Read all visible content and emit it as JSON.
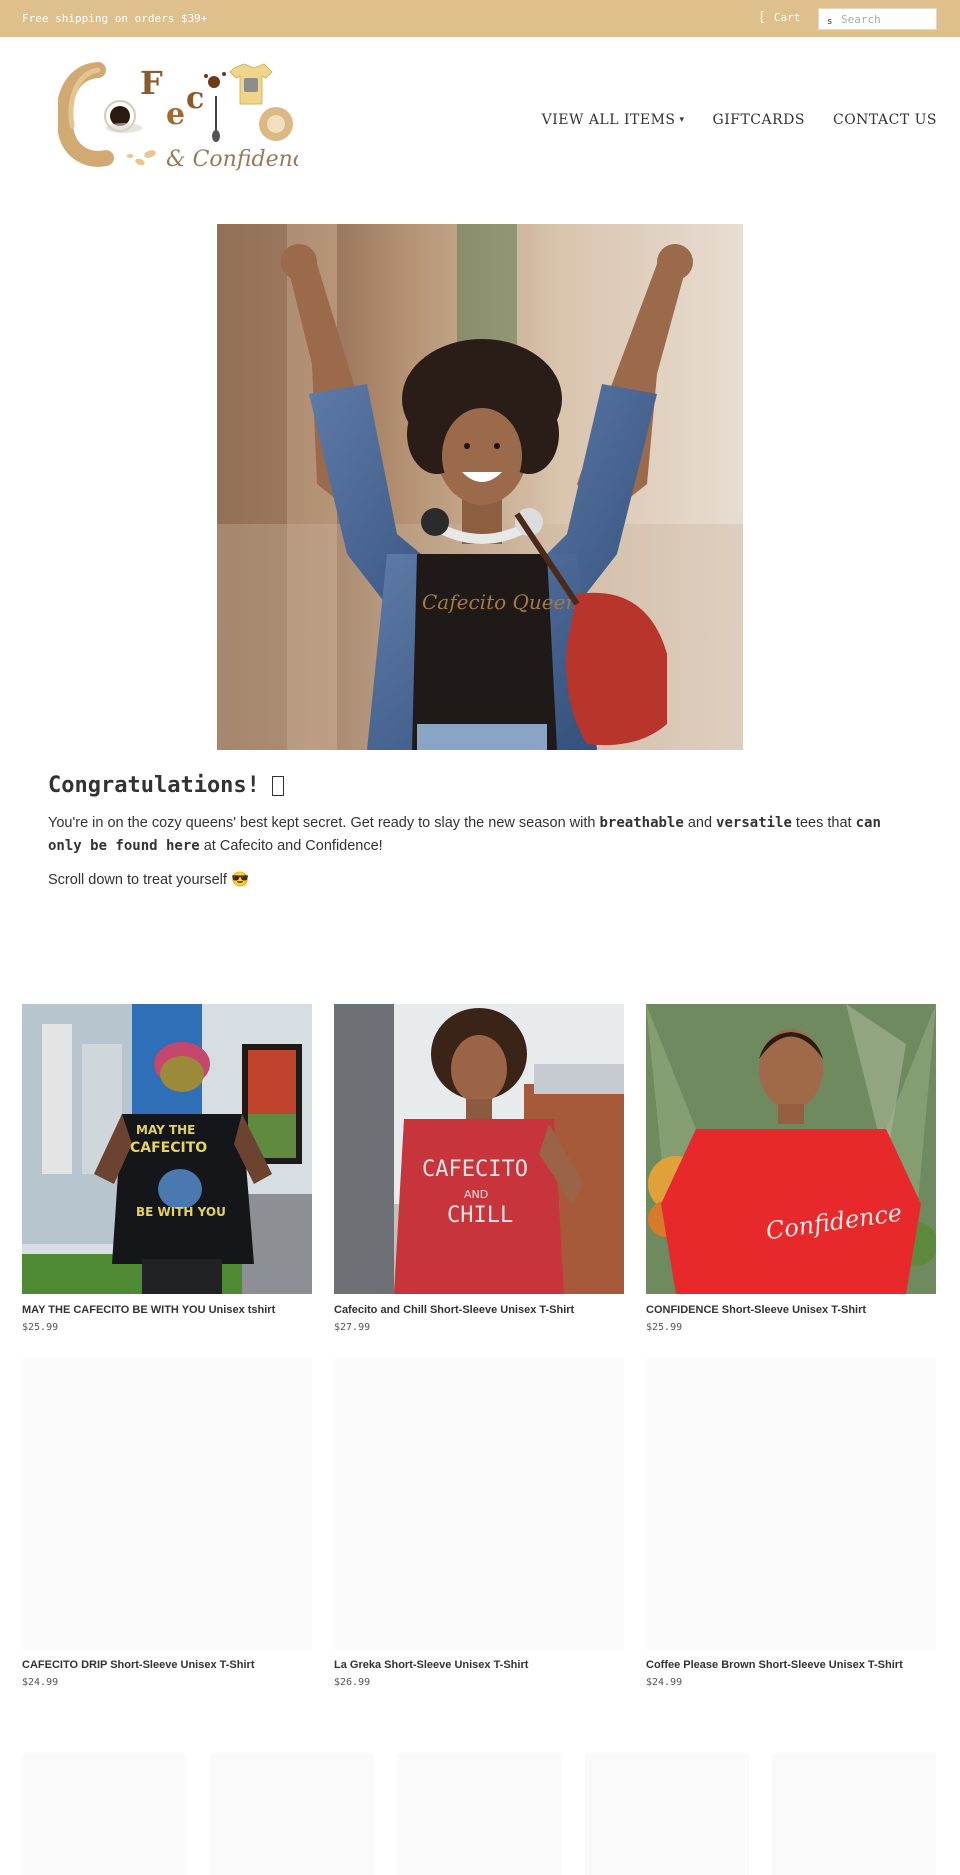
{
  "topbar": {
    "shipping_text": "Free shipping on orders $39+",
    "cart_label": "Cart",
    "cart_icon": "cart-icon",
    "search_placeholder": "Search",
    "search_icon_glyph": "s"
  },
  "logo": {
    "brand_text": "Cafecito & Confidence"
  },
  "nav": {
    "items": [
      {
        "label": "VIEW ALL ITEMS",
        "has_dropdown": true
      },
      {
        "label": "GIFTCARDS"
      },
      {
        "label": "CONTACT US"
      }
    ]
  },
  "intro": {
    "heading": "Congratulations!",
    "p1_a": "You're in on the cozy queens' best kept secret. Get ready to slay the new season with ",
    "p1_b": "breathable",
    "p1_c": " and ",
    "p1_d": "versatile",
    "p1_e": " tees that ",
    "p1_f": "can only be found here",
    "p1_g": " at Cafecito and Confidence!",
    "p2": "Scroll down to treat yourself 😎"
  },
  "products": [
    {
      "title": "MAY THE CAFECITO BE WITH YOU Unisex tshirt",
      "price": "$25.99",
      "shirt_text_1": "MAY THE",
      "shirt_text_2": "CAFECITO",
      "shirt_text_3": "BE WITH YOU"
    },
    {
      "title": "Cafecito and Chill Short-Sleeve Unisex T-Shirt",
      "price": "$27.99",
      "shirt_text_1": "CAFECITO",
      "shirt_text_2": "AND",
      "shirt_text_3": "CHILL"
    },
    {
      "title": "CONFIDENCE Short-Sleeve Unisex T-Shirt",
      "price": "$25.99",
      "shirt_text_1": "Confidence"
    },
    {
      "title": "CAFECITO DRIP Short-Sleeve Unisex T-Shirt",
      "price": "$24.99"
    },
    {
      "title": "La Greka Short-Sleeve Unisex T-Shirt",
      "price": "$26.99"
    },
    {
      "title": "Coffee Please Brown Short-Sleeve Unisex T-Shirt",
      "price": "$24.99"
    }
  ],
  "hero": {
    "shirt_text": "Cafecito Queen"
  },
  "colors": {
    "topbar_bg": "#dfc08c",
    "accent_gold": "#c9a063",
    "text_dark": "#333333"
  }
}
